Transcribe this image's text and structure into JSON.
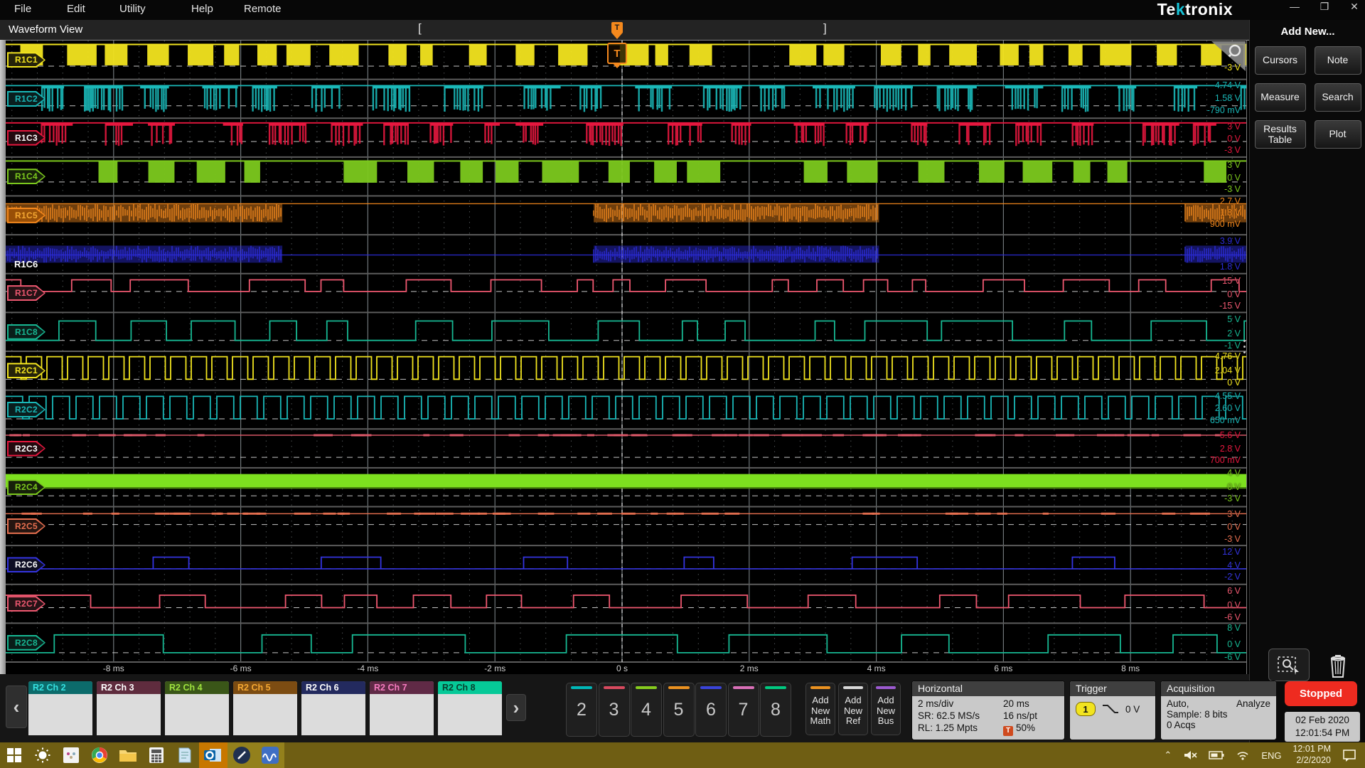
{
  "menu": {
    "items": [
      "File",
      "Edit",
      "Utility",
      "Help",
      "Remote"
    ],
    "logo_left": "Te",
    "logo_k": "k",
    "logo_right": "tronix"
  },
  "window_controls": {
    "minimize": "—",
    "restore": "❐",
    "close": "✕"
  },
  "view": {
    "tab": "Waveform View",
    "bracket_left": "[",
    "bracket_right": "]",
    "trigger_letter": "T"
  },
  "plot": {
    "time_labels": [
      "-8 ms",
      "-6 ms",
      "-4 ms",
      "-2 ms",
      "0 s",
      "2 ms",
      "4 ms",
      "6 ms",
      "8 ms"
    ],
    "channels": [
      {
        "id": "R1C1",
        "color": "#f2e41f",
        "badge": "outline",
        "text_color": "#f2e41f",
        "seed": 11,
        "zero": 0.66,
        "labels": [
          [
            "-3 V",
            0.56
          ]
        ],
        "wave": {
          "type": "blocks",
          "a": 0.1,
          "b": 0.64,
          "w1": 16,
          "w2": 46,
          "g1": 8,
          "g2": 52
        }
      },
      {
        "id": "R1C2",
        "color": "#1ab8b8",
        "badge": "outline",
        "text_color": "#1ab8b8",
        "seed": 22,
        "zero": 0.68,
        "labels": [
          [
            "4.74 V",
            0.02
          ],
          [
            "1.58 V",
            0.36
          ],
          [
            "-790 mV",
            0.66
          ]
        ],
        "wave": {
          "type": "stripes",
          "a": 0.16,
          "b": 0.84,
          "bw1": 22,
          "bw2": 60,
          "g1": 16,
          "g2": 66
        }
      },
      {
        "id": "R1C3",
        "color": "#e6173e",
        "badge": "outline",
        "text_color": "#ffffff",
        "seed": 33,
        "zero": 0.6,
        "labels": [
          [
            "3 V",
            0.08
          ],
          [
            "0 V",
            0.4
          ],
          [
            "-3 V",
            0.7
          ]
        ],
        "wave": {
          "type": "stripes",
          "a": 0.12,
          "b": 0.72,
          "bw1": 20,
          "bw2": 52,
          "g1": 18,
          "g2": 70
        }
      },
      {
        "id": "R1C4",
        "color": "#7cc91d",
        "badge": "outline",
        "text_color": "#7cc91d",
        "seed": 44,
        "zero": 0.64,
        "labels": [
          [
            "3 V",
            0.08
          ],
          [
            "0 V",
            0.4
          ],
          [
            "-3 V",
            0.7
          ]
        ],
        "wave": {
          "type": "blocks",
          "a": 0.1,
          "b": 0.66,
          "w1": 22,
          "w2": 52,
          "g1": 14,
          "g2": 60
        }
      },
      {
        "id": "R1C5",
        "color": "#f5891d",
        "badge": "glow",
        "text_color": "#f5a832",
        "seed": 55,
        "zero": null,
        "labels": [
          [
            "2.7 V",
            0.0
          ],
          [
            "1.8 V",
            0.3
          ],
          [
            "900 mV",
            0.6
          ]
        ],
        "wave": {
          "type": "noise",
          "cy": 0.44,
          "h": 0.24,
          "line": 0.2,
          "seg": [
            [
              0,
              0.223
            ],
            [
              0.474,
              0.704
            ],
            [
              0.951,
              1
            ]
          ]
        }
      },
      {
        "id": "R1C6",
        "color": "#2c2cd8",
        "badge": "plain",
        "text_color": "#ffffff",
        "seed": 66,
        "zero": null,
        "labels": [
          [
            "3.9 V",
            0.04
          ],
          [
            "1.8 V",
            0.7
          ]
        ],
        "wave": {
          "type": "noise",
          "cy": 0.5,
          "h": 0.22,
          "line": 0.52,
          "seg": [
            [
              0,
              0.223
            ],
            [
              0.474,
              0.704
            ],
            [
              0.951,
              1
            ]
          ]
        }
      },
      {
        "id": "R1C7",
        "color": "#ef5870",
        "badge": "outline",
        "text_color": "#ef5870",
        "seed": 77,
        "zero": 0.46,
        "labels": [
          [
            "15 V",
            0.06
          ],
          [
            "0 V",
            0.4
          ],
          [
            "-15 V",
            0.7
          ]
        ],
        "wave": {
          "type": "tele",
          "hi": 0.16,
          "lo": 0.46,
          "d1": 18,
          "d2": 95
        }
      },
      {
        "id": "R1C8",
        "color": "#17b893",
        "badge": "outline",
        "text_color": "#17b893",
        "seed": 88,
        "zero": 0.72,
        "labels": [
          [
            "5 V",
            0.04
          ],
          [
            "2 V",
            0.42
          ],
          [
            "-1 V",
            0.72
          ]
        ],
        "wave": {
          "type": "tele",
          "hi": 0.22,
          "lo": 0.72,
          "d1": 20,
          "d2": 100
        }
      },
      {
        "id": "R2C1",
        "color": "#f2e41f",
        "badge": "outline",
        "text_color": "#f2e41f",
        "seed": 19,
        "zero": 0.72,
        "labels": [
          [
            "4.76 V",
            0.0
          ],
          [
            "2.04 V",
            0.36
          ],
          [
            "0 V",
            0.68
          ]
        ],
        "wave": {
          "type": "clock",
          "hi": 0.14,
          "lo": 0.72,
          "p": 29,
          "duty": 0.74
        }
      },
      {
        "id": "R2C2",
        "color": "#1ab8b8",
        "badge": "outline",
        "text_color": "#1ab8b8",
        "seed": 29,
        "zero": 0.74,
        "labels": [
          [
            "4.55 V",
            0.02
          ],
          [
            "2.60 V",
            0.34
          ],
          [
            "650 mV",
            0.64
          ]
        ],
        "wave": {
          "type": "clock",
          "hi": 0.16,
          "lo": 0.74,
          "p": 33,
          "duty": 0.72
        }
      },
      {
        "id": "R2C3",
        "color": "#e6173e",
        "badge": "outline",
        "text_color": "#ffffff",
        "seed": 39,
        "zero": 0.73,
        "labels": [
          [
            "5.6 V",
            0.04
          ],
          [
            "2.8 V",
            0.38
          ],
          [
            "700 mV",
            0.68
          ]
        ],
        "wave": {
          "type": "flat",
          "y": 0.16,
          "n": 60,
          "line": "#e05a6a"
        }
      },
      {
        "id": "R2C4",
        "color": "#7cc91d",
        "badge": "outline",
        "text_color": "#7cc91d",
        "seed": 49,
        "zero": 0.72,
        "labels": [
          [
            "4 V",
            0.0
          ],
          [
            "0 V",
            0.36
          ],
          [
            "-3 V",
            0.66
          ]
        ],
        "wave": {
          "type": "band",
          "cy": 0.33,
          "h": 0.17,
          "fill": "#7de01f"
        }
      },
      {
        "id": "R2C5",
        "color": "#e87050",
        "badge": "outline",
        "text_color": "#e87050",
        "seed": 59,
        "zero": 0.46,
        "labels": [
          [
            "3 V",
            0.06
          ],
          [
            "0 V",
            0.4
          ],
          [
            "-3 V",
            0.7
          ]
        ],
        "wave": {
          "type": "flat",
          "y": 0.18,
          "n": 45,
          "line": "#e87050"
        }
      },
      {
        "id": "R2C6",
        "color": "#3434e0",
        "badge": "outline",
        "text_color": "#ffffff",
        "seed": 69,
        "zero": 0.6,
        "labels": [
          [
            "12 V",
            0.04
          ],
          [
            "4 V",
            0.38
          ],
          [
            "-2 V",
            0.68
          ]
        ],
        "wave": {
          "type": "pulses",
          "hi": 0.3,
          "lo": 0.6,
          "g1": 60,
          "g2": 220,
          "w1": 30,
          "w2": 95
        }
      },
      {
        "id": "R2C7",
        "color": "#ef5870",
        "badge": "outline",
        "text_color": "#ef5870",
        "seed": 79,
        "zero": 0.6,
        "labels": [
          [
            "6 V",
            0.04
          ],
          [
            "0 V",
            0.4
          ],
          [
            "-6 V",
            0.72
          ]
        ],
        "wave": {
          "type": "tele",
          "hi": 0.28,
          "lo": 0.6,
          "d1": 28,
          "d2": 120
        }
      },
      {
        "id": "R2C8",
        "color": "#17b893",
        "badge": "outline",
        "text_color": "#17b893",
        "seed": 89,
        "zero": 0.76,
        "labels": [
          [
            "8 V",
            0.0
          ],
          [
            "0 V",
            0.42
          ],
          [
            "-6 V",
            0.74
          ]
        ],
        "wave": {
          "type": "tele",
          "hi": 0.3,
          "lo": 0.76,
          "d1": 45,
          "d2": 170
        }
      }
    ]
  },
  "right_panel": {
    "title": "Add New...",
    "buttons": [
      "Cursors",
      "Note",
      "Measure",
      "Search",
      "Results Table",
      "Plot"
    ]
  },
  "bottom": {
    "prev_arrow": "‹",
    "next_arrow": "›",
    "tabs": [
      {
        "label": "R2 Ch 2",
        "hdr": "#0c6b6b",
        "txt": "#35e0e0"
      },
      {
        "label": "R2 Ch 3",
        "hdr": "#5f2c3e",
        "txt": "#ffffff"
      },
      {
        "label": "R2 Ch 4",
        "hdr": "#3a5618",
        "txt": "#9fe23f"
      },
      {
        "label": "R2 Ch 5",
        "hdr": "#7c4c12",
        "txt": "#f5a832"
      },
      {
        "label": "R2 Ch 6",
        "hdr": "#232a5e",
        "txt": "#ffffff"
      },
      {
        "label": "R2 Ch 7",
        "hdr": "#602a46",
        "txt": "#f77cc0"
      },
      {
        "label": "R2 Ch 8",
        "hdr": "#06c998",
        "txt": "#073f2d"
      }
    ],
    "numbers": [
      {
        "label": "2",
        "strip": "#00b8b8"
      },
      {
        "label": "3",
        "strip": "#d84a5f"
      },
      {
        "label": "4",
        "strip": "#86cb1e"
      },
      {
        "label": "5",
        "strip": "#eb9220"
      },
      {
        "label": "6",
        "strip": "#3a44da"
      },
      {
        "label": "7",
        "strip": "#da70b8"
      },
      {
        "label": "8",
        "strip": "#00c980"
      }
    ],
    "adds": [
      {
        "lines": [
          "Add",
          "New",
          "Math"
        ],
        "strip": "#eb9220"
      },
      {
        "lines": [
          "Add",
          "New",
          "Ref"
        ],
        "strip": "#d8d8d8"
      },
      {
        "lines": [
          "Add",
          "New",
          "Bus"
        ],
        "strip": "#9c5ad0"
      }
    ],
    "horizontal": {
      "title": "Horizontal",
      "scale": "2 ms/div",
      "span": "20 ms",
      "sr": "SR: 62.5 MS/s",
      "res": "16 ns/pt",
      "rl": "RL: 1.25 Mpts",
      "pos": "50%",
      "pos_icon": "T"
    },
    "trigger": {
      "title": "Trigger",
      "source": "1",
      "level": "0 V"
    },
    "acquisition": {
      "title": "Acquisition",
      "mode": "Auto,",
      "analyze": "Analyze",
      "sample": "Sample: 8 bits",
      "acqs": "0 Acqs"
    },
    "stopped": "Stopped",
    "date": "02 Feb 2020",
    "time": "12:01:54 PM"
  },
  "taskbar": {
    "icons": [
      "start",
      "sun",
      "people",
      "chrome",
      "explorer",
      "calculator",
      "notepad",
      "outlook",
      "pen",
      "tekscope"
    ],
    "tray": {
      "chevron": "⌃",
      "lang": "ENG",
      "time": "12:01 PM",
      "date": "2/2/2020"
    }
  }
}
